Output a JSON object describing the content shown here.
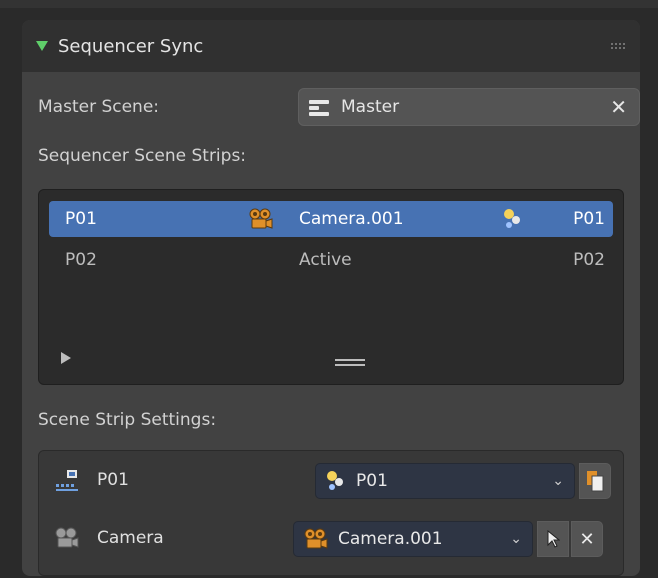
{
  "panel": {
    "title": "Sequencer Sync"
  },
  "master": {
    "label": "Master Scene:",
    "value": "Master"
  },
  "strips": {
    "label": "Sequencer Scene Strips:",
    "items": [
      {
        "name": "P01",
        "camera": "Camera.001",
        "scene": "P01",
        "selected": true
      },
      {
        "name": "P02",
        "camera": "Active",
        "scene": "P02",
        "selected": false
      }
    ]
  },
  "settings": {
    "label": "Scene Strip Settings:",
    "scene_row": {
      "label": "P01",
      "value": "P01"
    },
    "camera_row": {
      "label": "Camera",
      "value": "Camera.001"
    }
  },
  "colors": {
    "accent": "#4772b3",
    "header_triangle": "#5fcf6a",
    "camera_icon": "#e0902a"
  }
}
